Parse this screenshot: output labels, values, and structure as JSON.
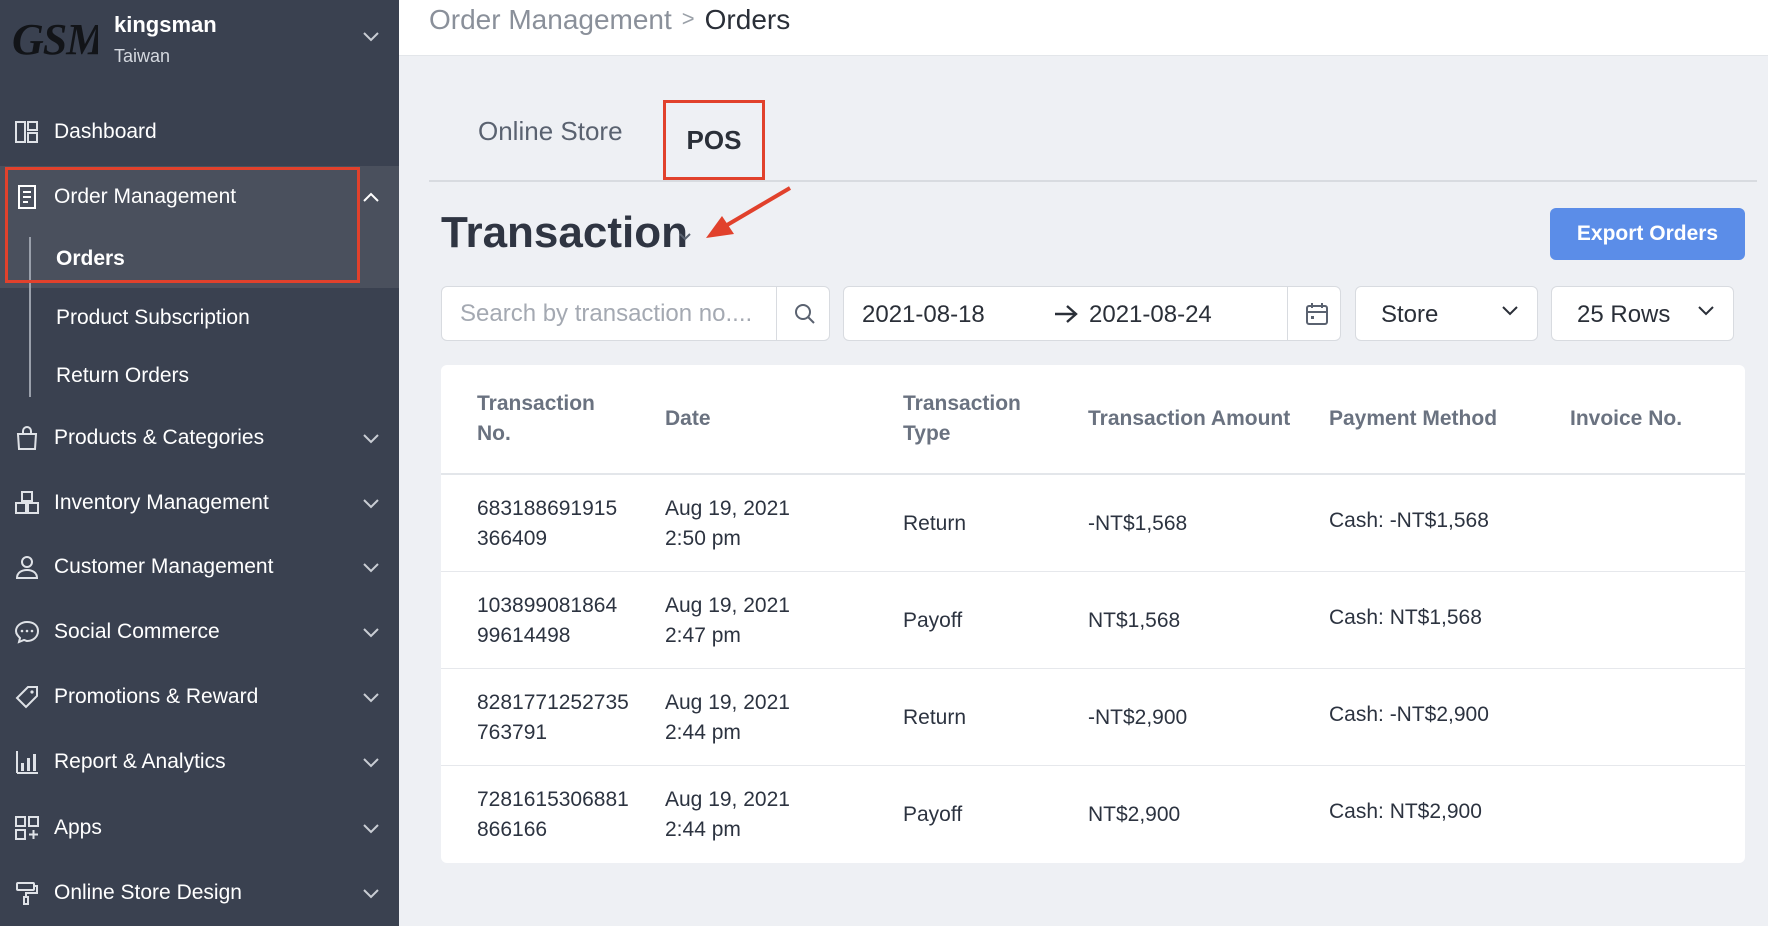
{
  "shop": {
    "logo_text": "GSM",
    "name": "kingsman",
    "region": "Taiwan"
  },
  "sidebar": {
    "items": [
      {
        "label": "Dashboard",
        "icon": "dashboard-icon"
      },
      {
        "label": "Order Management",
        "icon": "clipboard-icon",
        "expanded": true,
        "children": [
          "Orders",
          "Product Subscription",
          "Return Orders"
        ]
      },
      {
        "label": "Products & Categories",
        "icon": "shopping-bag-icon"
      },
      {
        "label": "Inventory Management",
        "icon": "boxes-icon"
      },
      {
        "label": "Customer Management",
        "icon": "user-icon"
      },
      {
        "label": "Social Commerce",
        "icon": "chat-bubble-icon"
      },
      {
        "label": "Promotions & Reward",
        "icon": "tag-icon"
      },
      {
        "label": "Report & Analytics",
        "icon": "bar-chart-icon"
      },
      {
        "label": "Apps",
        "icon": "apps-grid-icon"
      },
      {
        "label": "Online Store Design",
        "icon": "paint-roller-icon"
      }
    ]
  },
  "breadcrumb": {
    "parent": "Order Management",
    "separator": ">",
    "current": "Orders"
  },
  "tabs": [
    {
      "label": "Online Store",
      "active": false
    },
    {
      "label": "POS",
      "active": true
    }
  ],
  "page_title": "Transaction",
  "export_button": "Export Orders",
  "filters": {
    "search_placeholder": "Search by transaction no....",
    "date_from": "2021-08-18",
    "date_to": "2021-08-24",
    "store_select": "Store",
    "rows_select": "25 Rows"
  },
  "table": {
    "headers": [
      "Transaction No.",
      "Date",
      "Transaction Type",
      "Transaction Amount",
      "Payment Method",
      "Invoice No."
    ],
    "rows": [
      {
        "no": [
          "683188691915",
          "366409"
        ],
        "date": [
          "Aug 19, 2021",
          "2:50 pm"
        ],
        "type": "Return",
        "amount": "-NT$1,568",
        "payment": "Cash: -NT$1,568",
        "invoice": ""
      },
      {
        "no": [
          "103899081864",
          "99614498"
        ],
        "date": [
          "Aug 19, 2021",
          "2:47 pm"
        ],
        "type": "Payoff",
        "amount": "NT$1,568",
        "payment": "Cash: NT$1,568",
        "invoice": ""
      },
      {
        "no": [
          "8281771252735",
          "763791"
        ],
        "date": [
          "Aug 19, 2021",
          "2:44 pm"
        ],
        "type": "Return",
        "amount": "-NT$2,900",
        "payment": "Cash: -NT$2,900",
        "invoice": ""
      },
      {
        "no": [
          "7281615306881",
          "866166"
        ],
        "date": [
          "Aug 19, 2021",
          "2:44 pm"
        ],
        "type": "Payoff",
        "amount": "NT$2,900",
        "payment": "Cash: NT$2,900",
        "invoice": ""
      }
    ]
  },
  "colors": {
    "sidebar_bg": "#3a4150",
    "highlight": "#e1412c",
    "primary_button": "#5b8de8",
    "page_bg": "#eef0f4"
  }
}
